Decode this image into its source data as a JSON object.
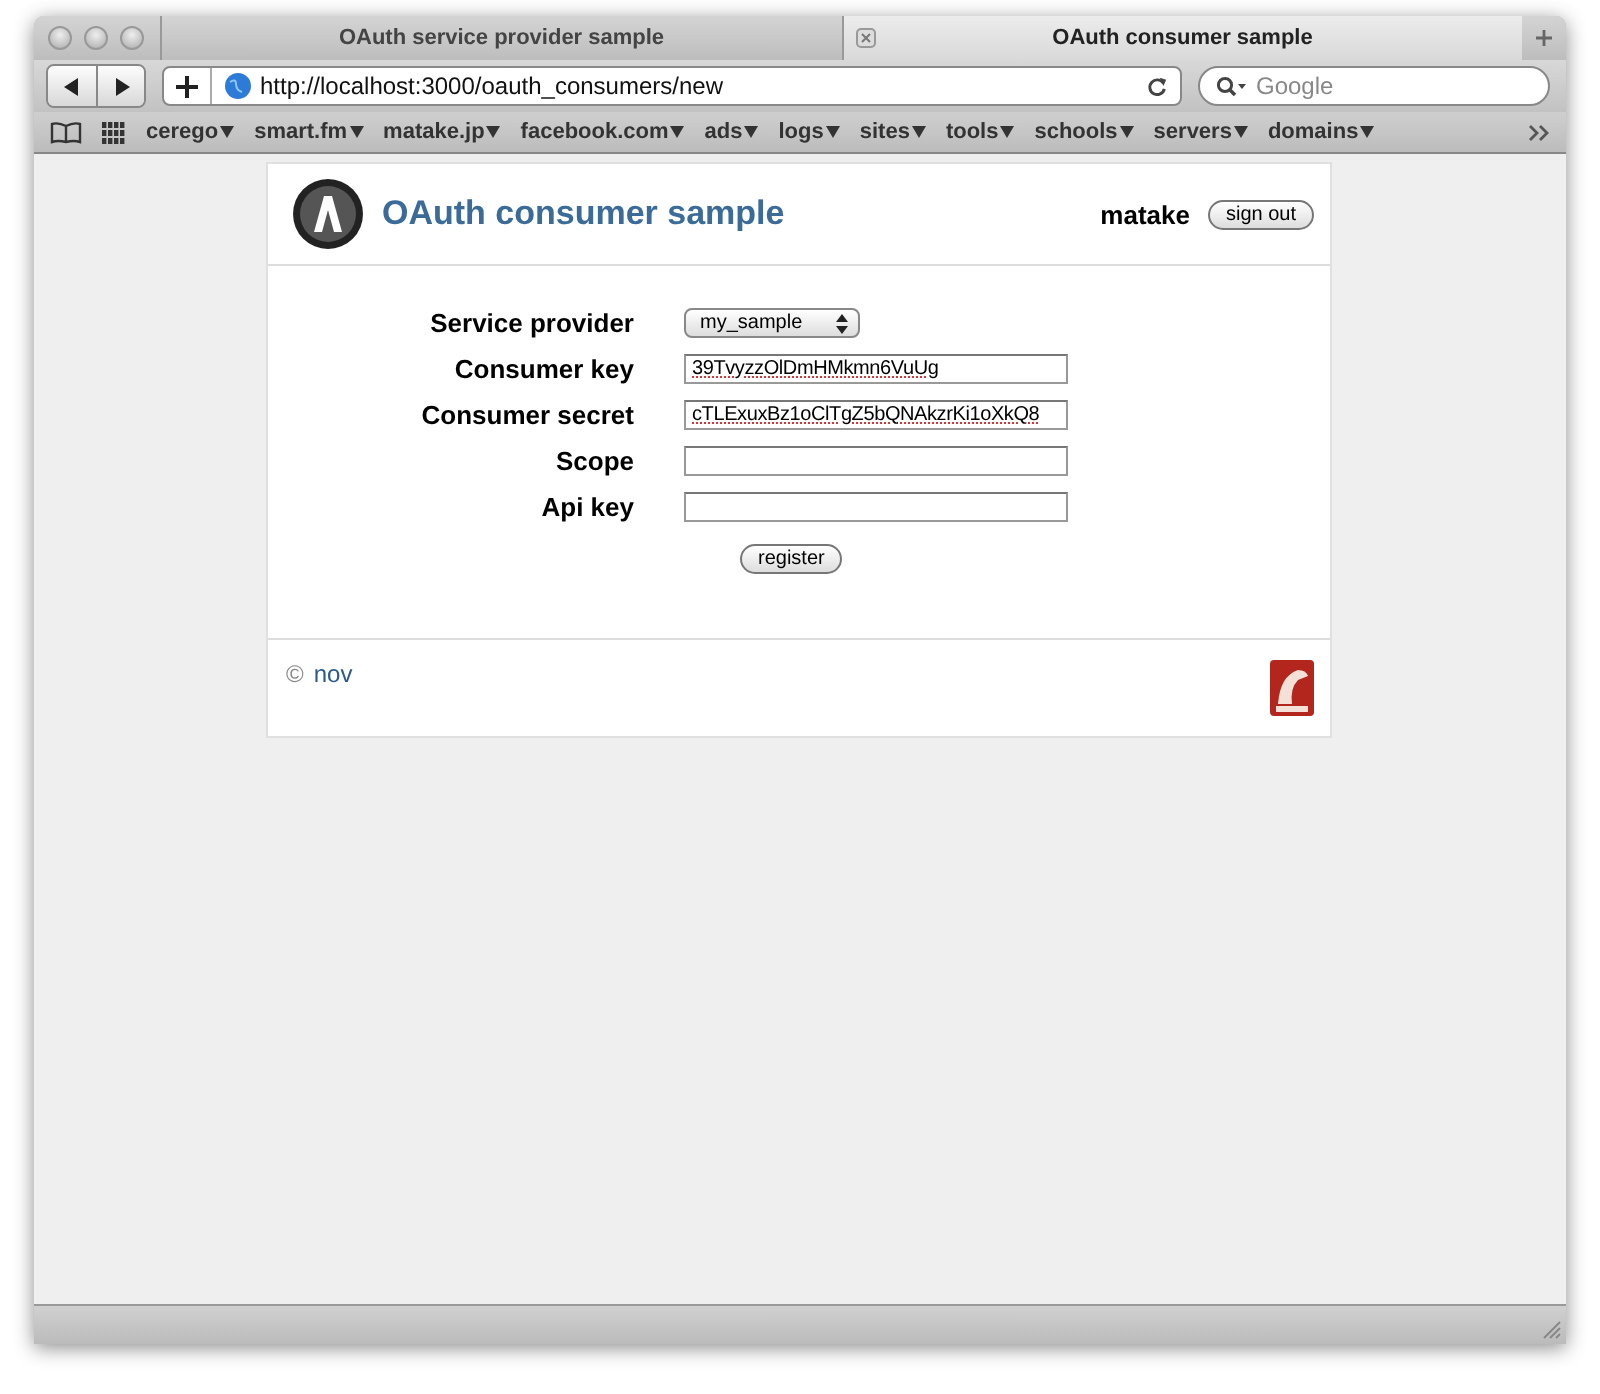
{
  "tabs": [
    {
      "label": "OAuth service provider sample",
      "selected": false
    },
    {
      "label": "OAuth consumer sample",
      "selected": true
    }
  ],
  "address": {
    "value": "http://localhost:3000/oauth_consumers/new"
  },
  "search": {
    "placeholder": "Google"
  },
  "bookmarks": [
    {
      "label": "cerego"
    },
    {
      "label": "smart.fm"
    },
    {
      "label": "matake.jp"
    },
    {
      "label": "facebook.com"
    },
    {
      "label": "ads"
    },
    {
      "label": "logs"
    },
    {
      "label": "sites"
    },
    {
      "label": "tools"
    },
    {
      "label": "schools"
    },
    {
      "label": "servers"
    },
    {
      "label": "domains"
    }
  ],
  "page": {
    "title": "OAuth consumer sample",
    "user": "matake",
    "sign_out": "sign out",
    "fields": [
      {
        "kind": "select",
        "label": "Service provider",
        "value": "my_sample"
      },
      {
        "kind": "text",
        "label": "Consumer key",
        "value": "39TvyzzOlDmHMkmn6VuUg"
      },
      {
        "kind": "text",
        "label": "Consumer secret",
        "value": "cTLExuxBz1oClTgZ5bQNAkzrKi1oXkQ8"
      },
      {
        "kind": "text",
        "label": "Scope"
      },
      {
        "kind": "text",
        "label": "Api key"
      }
    ],
    "submit": "register",
    "footer_symbol": "©",
    "footer_link": "nov"
  }
}
